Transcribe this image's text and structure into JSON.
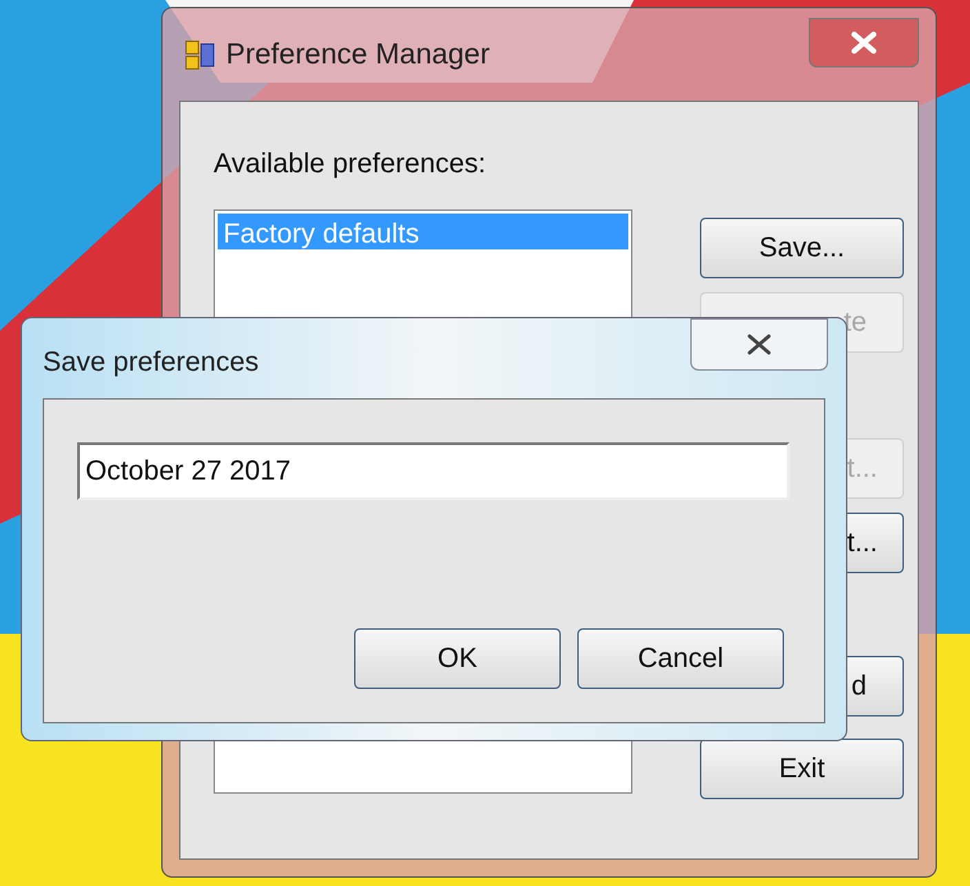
{
  "main_window": {
    "title": "Preference Manager",
    "list_label": "Available preferences:",
    "preferences": [
      {
        "name": "Factory defaults",
        "selected": true
      }
    ],
    "buttons": [
      {
        "label": "Save...",
        "disabled": false
      },
      {
        "label": "te",
        "disabled": true
      },
      {
        "label": "t...",
        "disabled": true
      },
      {
        "label": "t...",
        "disabled": false
      },
      {
        "label": "d",
        "disabled": false
      },
      {
        "label": "Exit",
        "disabled": false
      }
    ]
  },
  "dialog": {
    "title": "Save preferences",
    "name_field": {
      "value": "October 27 2017"
    },
    "buttons": [
      "OK",
      "Cancel"
    ]
  }
}
